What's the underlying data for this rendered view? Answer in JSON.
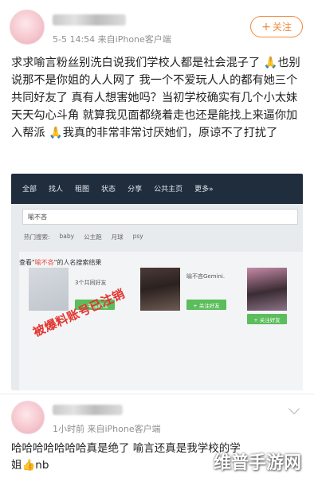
{
  "post": {
    "meta": "5-5 14:54  来自iPhone客户端",
    "follow_label": "关注",
    "text": "求求喻言粉丝别洗白说我们学校人都是社会混子了 🙏也别说那不是你姐的人人网了 我一个不爱玩人人的都有她三个共同好友了 真有人想害她吗？当初学校确实有几个小太妹 天天勾心斗角 就算我见面都绕着走也还是能找上来逼你加入帮派 🙏我真的非常非常讨厌她们，原谅不了打扰了"
  },
  "screenshot": {
    "tabs": [
      "全部",
      "找人",
      "租图",
      "状态",
      "分享",
      "公共主页",
      "更多»"
    ],
    "search_value": "喻不吝",
    "hot_search": [
      "热门搜索:",
      "baby",
      "公主跑",
      "月球",
      "psy"
    ],
    "result_prefix": "查看\"",
    "result_keyword": "喻不吝",
    "result_suffix": "\"的人名搜索结果",
    "card1_text": "3个共同好友",
    "card2_name": "喻不吝Gemini.",
    "add_friend_label": "+ 关注好友",
    "stamp": "被爆料账号已注销"
  },
  "comment": {
    "meta": "1小时前  来自iPhone客户端",
    "text": "哈哈哈哈哈哈哈真是绝了 喻言还真是我学校的学姐👍nb"
  },
  "watermark": "维普手游网",
  "colors": {
    "accent": "#f08a3c",
    "nav_dark": "#1f2d3d",
    "stamp_red": "#e3342f",
    "button_green": "#5bbd5b"
  }
}
